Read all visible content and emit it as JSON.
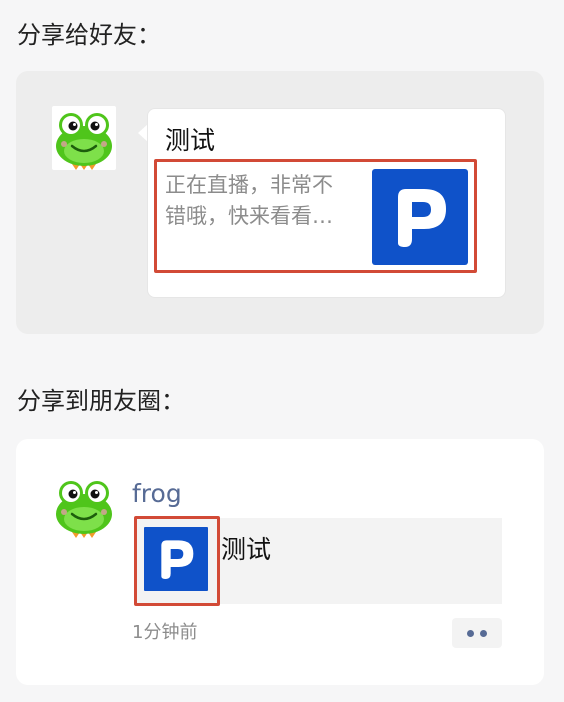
{
  "sections": {
    "friend_heading": "分享给好友：",
    "moments_heading": "分享到朋友圈："
  },
  "friend_share": {
    "title": "测试",
    "description_line1": "正在直播，非常不",
    "description_line2": "错哦，快来看看…"
  },
  "moments_share": {
    "nickname": "frog",
    "card_title": "测试",
    "time": "1分钟前"
  },
  "icons": {
    "avatar": "frog-avatar-icon",
    "logo": "p-logo-icon",
    "more": "more-dots-icon"
  },
  "colors": {
    "highlight": "#d24a36",
    "logo_bg": "#0f52c9",
    "nickname": "#576b95"
  }
}
